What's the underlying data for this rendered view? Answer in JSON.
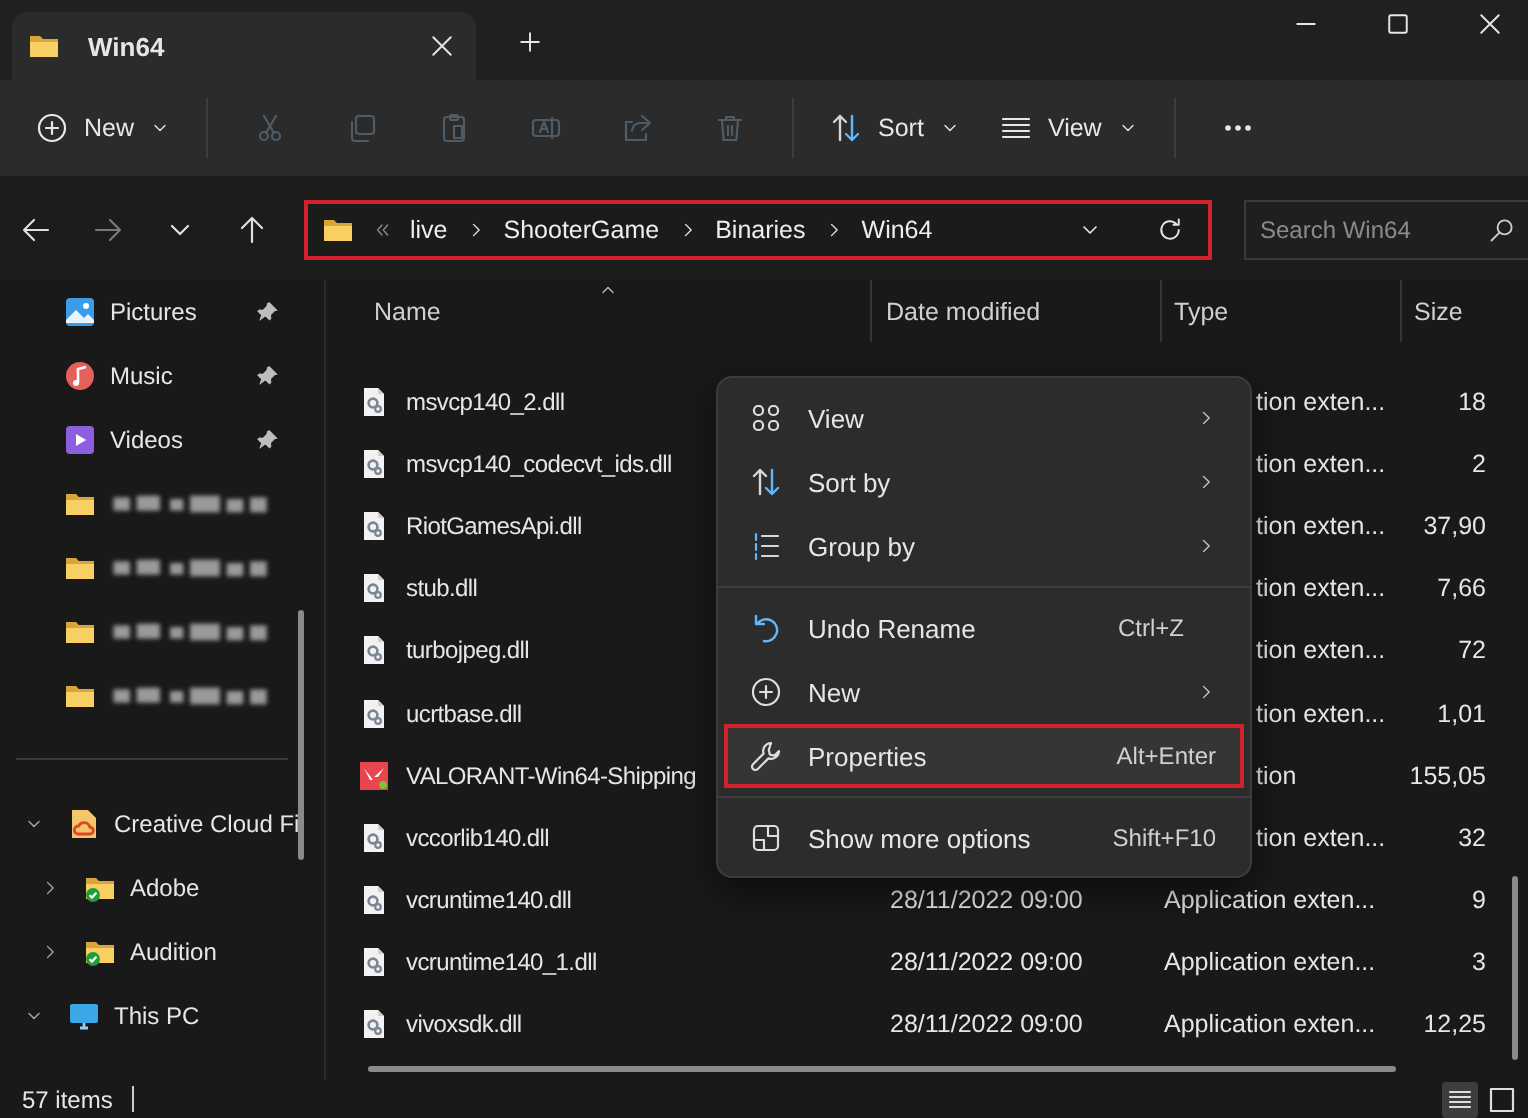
{
  "window": {
    "tab": {
      "title": "Win64"
    }
  },
  "toolbar": {
    "groups": [
      [
        {
          "kind": "new",
          "label": "New",
          "dropdown": true,
          "disabled": false
        }
      ],
      [
        {
          "kind": "cut",
          "disabled": true
        },
        {
          "kind": "copy",
          "disabled": true
        },
        {
          "kind": "paste",
          "disabled": true
        },
        {
          "kind": "rename",
          "disabled": true
        },
        {
          "kind": "share",
          "disabled": true
        },
        {
          "kind": "delete",
          "disabled": true
        }
      ],
      [
        {
          "kind": "sort",
          "label": "Sort",
          "dropdown": true,
          "disabled": false
        },
        {
          "kind": "view",
          "label": "View",
          "dropdown": true,
          "disabled": false
        }
      ],
      [
        {
          "kind": "more",
          "disabled": false
        }
      ]
    ]
  },
  "navigation": [
    {
      "kind": "back",
      "disabled": false
    },
    {
      "kind": "forward",
      "disabled": true
    },
    {
      "kind": "recent",
      "disabled": false
    },
    {
      "kind": "up",
      "disabled": false
    }
  ],
  "address_bar": {
    "highlighted": true,
    "breadcrumbs": [
      "live",
      "ShooterGame",
      "Binaries",
      "Win64"
    ]
  },
  "search": {
    "placeholder": "Search Win64"
  },
  "sidebar": {
    "items": [
      {
        "kind": "pictures",
        "label": "Pictures",
        "pinned": true
      },
      {
        "kind": "music",
        "label": "Music",
        "pinned": true
      },
      {
        "kind": "videos",
        "label": "Videos",
        "pinned": true
      },
      {
        "kind": "redacted",
        "pinned": false
      },
      {
        "kind": "redacted",
        "pinned": false
      },
      {
        "kind": "redacted",
        "pinned": false
      },
      {
        "kind": "redacted",
        "pinned": false
      }
    ],
    "tree": [
      {
        "kind": "cloud-folder",
        "label": "Creative Cloud Fi",
        "expanded": true,
        "children": [
          {
            "kind": "synced-folder",
            "label": "Adobe",
            "expanded": false
          },
          {
            "kind": "synced-folder",
            "label": "Audition",
            "expanded": false
          }
        ]
      },
      {
        "kind": "pc",
        "label": "This PC",
        "expanded": true
      }
    ]
  },
  "table": {
    "columns": [
      {
        "label": "Name",
        "sorted": true
      },
      {
        "label": "Date modified",
        "sorted": false
      },
      {
        "label": "Type",
        "sorted": false
      },
      {
        "label": "Size",
        "sorted": false
      }
    ],
    "rows": [
      {
        "kind": "dll",
        "name": "msvcp140_2.dll",
        "type": "tion exten...",
        "size": "18"
      },
      {
        "kind": "dll",
        "name": "msvcp140_codecvt_ids.dll",
        "type": "tion exten...",
        "size": "2"
      },
      {
        "kind": "dll",
        "name": "RiotGamesApi.dll",
        "type": "tion exten...",
        "size": "37,90"
      },
      {
        "kind": "dll",
        "name": "stub.dll",
        "type": "tion exten...",
        "size": "7,66"
      },
      {
        "kind": "dll",
        "name": "turbojpeg.dll",
        "type": "tion exten...",
        "size": "72"
      },
      {
        "kind": "dll",
        "name": "ucrtbase.dll",
        "type": "tion exten...",
        "size": "1,01"
      },
      {
        "kind": "app",
        "name": "VALORANT-Win64-Shipping",
        "type": "tion",
        "size": "155,05"
      },
      {
        "kind": "dll",
        "name": "vccorlib140.dll",
        "type": "tion exten...",
        "size": "32"
      },
      {
        "kind": "dll",
        "name": "vcruntime140.dll",
        "date": "28/11/2022 09:00",
        "type": "Application exten...",
        "size": "9"
      },
      {
        "kind": "dll",
        "name": "vcruntime140_1.dll",
        "date": "28/11/2022 09:00",
        "type": "Application exten...",
        "size": "3"
      },
      {
        "kind": "dll",
        "name": "vivoxsdk.dll",
        "date": "28/11/2022 09:00",
        "type": "Application exten...",
        "size": "12,25"
      }
    ]
  },
  "context_menu": {
    "items": [
      {
        "kind": "view",
        "label": "View",
        "submenu": true,
        "highlighted": false
      },
      {
        "kind": "sort",
        "label": "Sort by",
        "submenu": true,
        "highlighted": false
      },
      {
        "kind": "group",
        "label": "Group by",
        "submenu": true,
        "highlighted": false
      },
      {
        "kind": "separator"
      },
      {
        "kind": "undo",
        "label": "Undo Rename",
        "shortcut": "Ctrl+Z",
        "submenu": false,
        "highlighted": false
      },
      {
        "kind": "new",
        "label": "New",
        "submenu": true,
        "highlighted": false
      },
      {
        "kind": "properties",
        "label": "Properties",
        "shortcut": "Alt+Enter",
        "submenu": false,
        "highlighted": true
      },
      {
        "kind": "separator"
      },
      {
        "kind": "more-options",
        "label": "Show more options",
        "shortcut": "Shift+F10",
        "submenu": false,
        "highlighted": false
      }
    ]
  },
  "status_bar": {
    "item_count": "57 items",
    "view_buttons": [
      {
        "kind": "details",
        "selected": true
      },
      {
        "kind": "tiles",
        "selected": false
      }
    ]
  }
}
